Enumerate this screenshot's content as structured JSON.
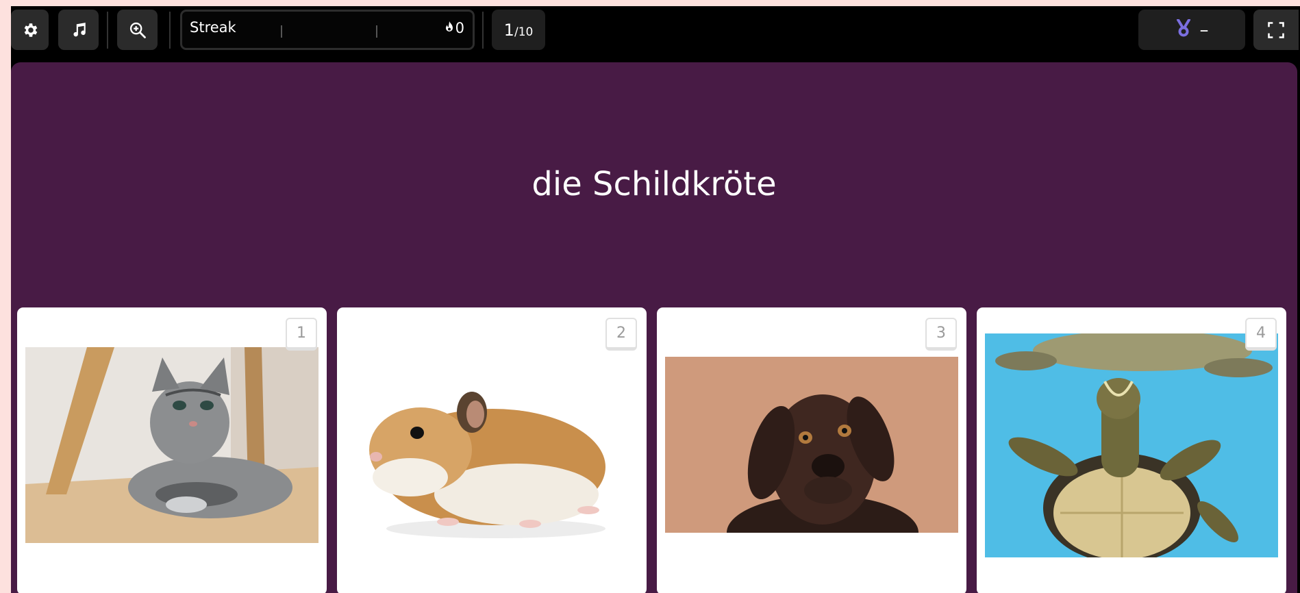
{
  "toolbar": {
    "settings_icon": "gear-icon",
    "music_icon": "music-note-icon",
    "zoom_icon": "zoom-in-icon",
    "fullscreen_icon": "fullscreen-icon"
  },
  "streak": {
    "label": "Streak",
    "count": "0",
    "icon": "flame-icon"
  },
  "progress": {
    "current": "1",
    "separator": "/",
    "total": "10"
  },
  "medal": {
    "icon": "medal-icon",
    "value": "–",
    "color": "#7b6fe0"
  },
  "question": {
    "text": "die Schildkröte"
  },
  "answers": [
    {
      "number": "1",
      "image": "cat-photo"
    },
    {
      "number": "2",
      "image": "hamster-photo"
    },
    {
      "number": "3",
      "image": "dog-photo"
    },
    {
      "number": "4",
      "image": "turtle-photo"
    }
  ],
  "colors": {
    "page_background": "#fde1de",
    "panel": "#481b45",
    "toolbar": "#000000"
  }
}
